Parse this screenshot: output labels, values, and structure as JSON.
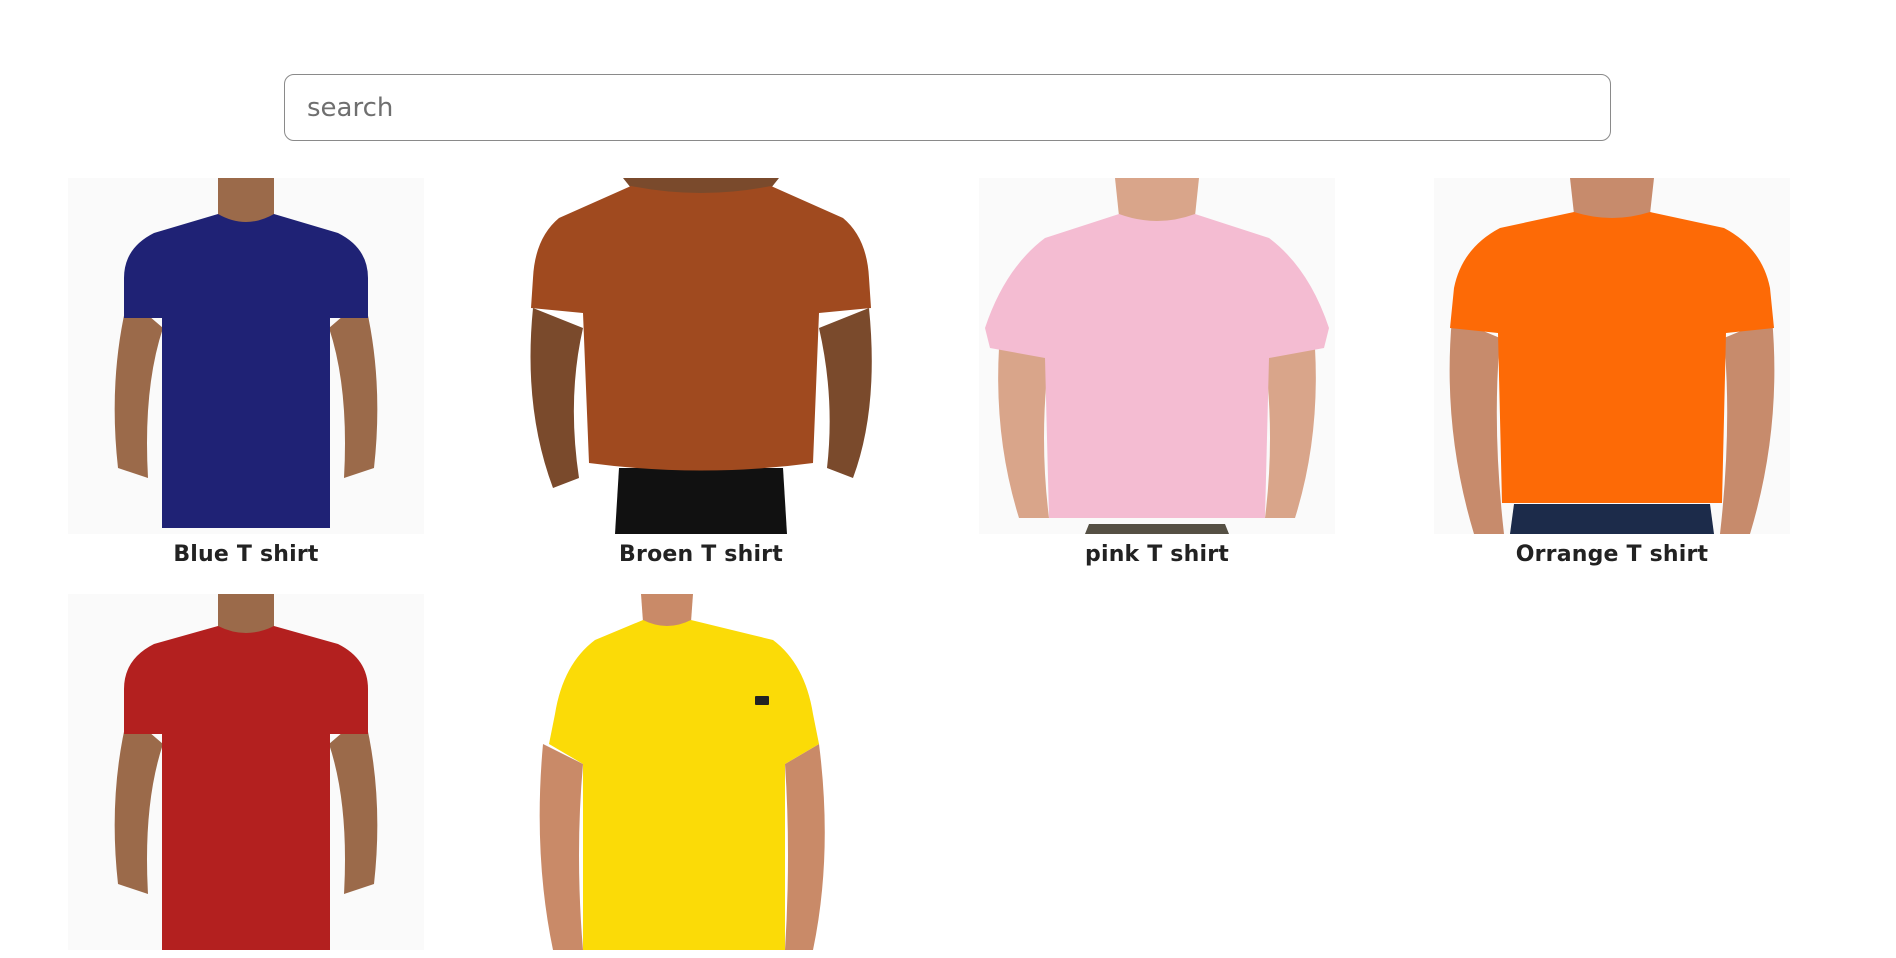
{
  "search": {
    "placeholder": "search",
    "value": ""
  },
  "products": [
    {
      "name": "Blue T shirt",
      "shirt_color": "#1f2275",
      "skin_color": "#9b6a4a",
      "background": "#fafafa"
    },
    {
      "name": "Broen T shirt",
      "shirt_color": "#a04a1f",
      "skin_color": "#7a4a2c",
      "background": "#ffffff"
    },
    {
      "name": "pink T shirt",
      "shirt_color": "#f4bcd2",
      "skin_color": "#d9a58a",
      "background": "#fafafa"
    },
    {
      "name": "Orrange T shirt",
      "shirt_color": "#fd6a06",
      "skin_color": "#c78b6c",
      "background": "#fafafa"
    },
    {
      "name": "",
      "shirt_color": "#b3201f",
      "skin_color": "#9b6a4a",
      "background": "#fafafa"
    },
    {
      "name": "",
      "shirt_color": "#fbdb07",
      "skin_color": "#c98a68",
      "background": "#ffffff"
    }
  ]
}
